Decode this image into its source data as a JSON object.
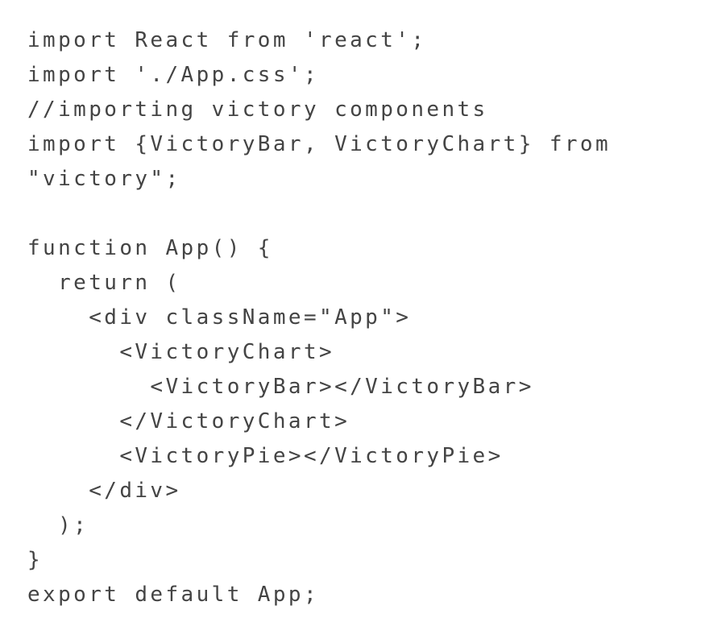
{
  "code": {
    "lines": [
      "import React from 'react';",
      "import './App.css';",
      "//importing victory components",
      "import {VictoryBar, VictoryChart} from",
      "\"victory\";",
      "",
      "function App() {",
      "  return (",
      "    <div className=\"App\">",
      "      <VictoryChart>",
      "        <VictoryBar></VictoryBar>",
      "      </VictoryChart>",
      "      <VictoryPie></VictoryPie>",
      "    </div>",
      "  );",
      "}",
      "export default App;"
    ]
  },
  "colors": {
    "text": "#444444",
    "background": "#ffffff"
  }
}
